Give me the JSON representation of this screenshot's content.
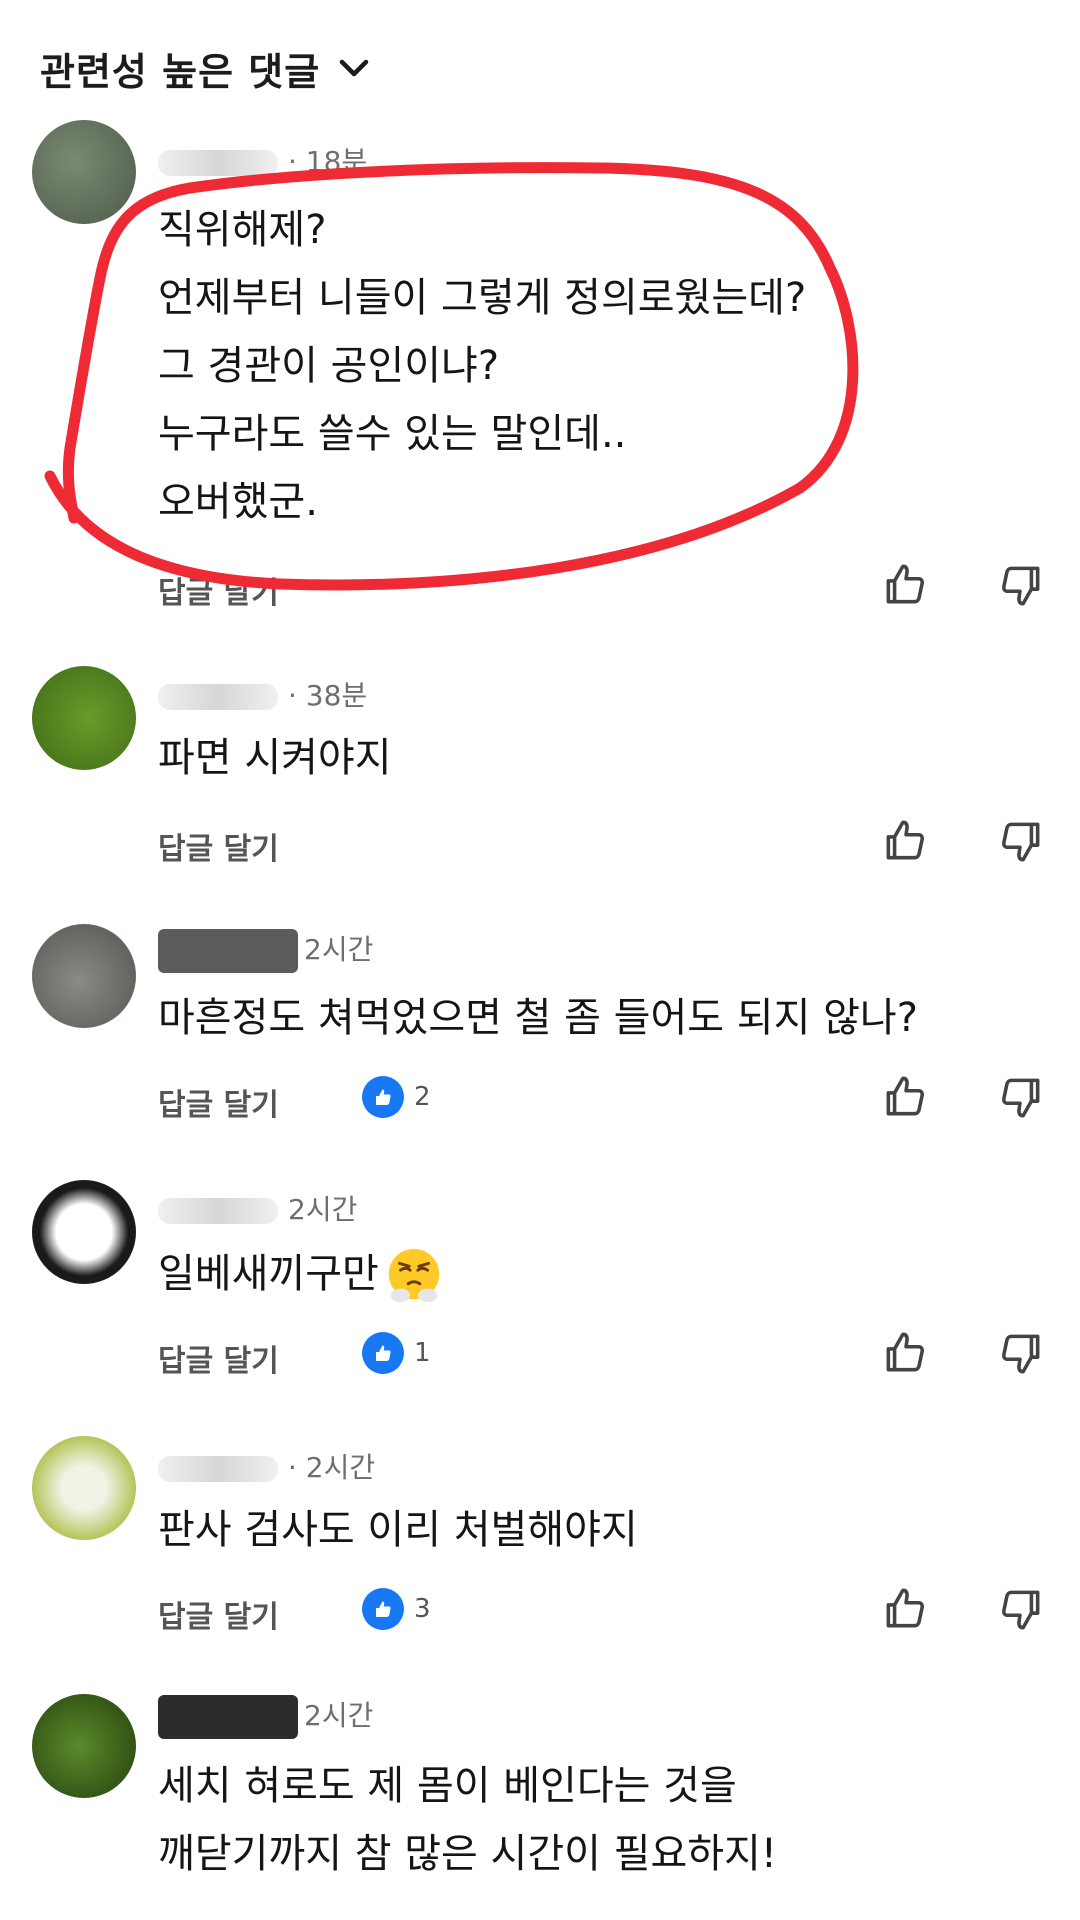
{
  "header": {
    "title": "관련성 높은 댓글",
    "chevron_icon": "chevron-down-icon"
  },
  "comments": [
    {
      "author_redacted": true,
      "time": "· 18분",
      "lines": [
        "직위해제?",
        "언제부터 니들이 그렇게 정의로웠는데?",
        "그 경관이 공인이냐?",
        "누구라도 쓸수 있는 말인데..",
        "오버했군."
      ],
      "reply_label": "답글 달기",
      "likes": null,
      "highlighted": true
    },
    {
      "author_redacted": true,
      "time": "· 38분",
      "lines": [
        "파면 시켜야지"
      ],
      "reply_label": "답글 달기",
      "likes": null
    },
    {
      "author_redacted": true,
      "time": "2시간",
      "lines": [
        "마흔정도 쳐먹었으면 철 좀 들어도 되지 않나?"
      ],
      "reply_label": "답글 달기",
      "likes": "2"
    },
    {
      "author_redacted": true,
      "time": "2시간",
      "lines": [
        "일베새끼구만"
      ],
      "emoji": "steam-from-nose-emoji",
      "reply_label": "답글 달기",
      "likes": "1"
    },
    {
      "author_redacted": true,
      "time": "· 2시간",
      "lines": [
        "판사 검사도 이리 처벌해야지"
      ],
      "reply_label": "답글 달기",
      "likes": "3"
    },
    {
      "author_redacted": true,
      "time": "2시간",
      "lines": [
        "세치 혀로도 제 몸이 베인다는 것을",
        "깨닫기까지 참 많은 시간이 필요하지!"
      ],
      "reply_label": "",
      "likes": null
    }
  ],
  "colors": {
    "annotation_red": "#ee2a35",
    "like_blue": "#1877f2"
  },
  "icons": {
    "like": "thumbs-up-icon",
    "dislike": "thumbs-down-icon",
    "like_badge": "like-badge-icon"
  }
}
